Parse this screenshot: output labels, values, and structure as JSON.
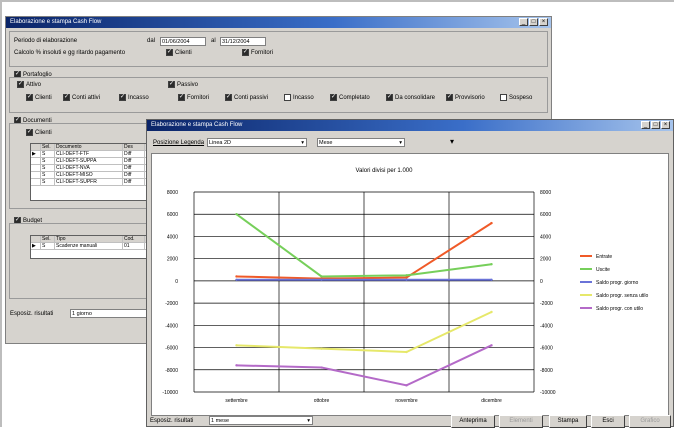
{
  "back_window": {
    "title": "Elaborazione e stampa Cash Flow",
    "periodo_label": "Periodo di elaborazione",
    "dal_label": "dal",
    "date_from": "01/06/2004",
    "al_label": "al",
    "date_to": "31/12/2004",
    "calcolo_label": "Calcolo % insoluti e gg ritardo pagamento",
    "clienti": "Clienti",
    "fornitori": "Fornitori",
    "portafoglio": "Portafoglio",
    "attivo": "Attivo",
    "attivo_items": [
      "Clienti",
      "Conti attivi",
      "Incasso"
    ],
    "passivo": "Passivo",
    "passivo_items": [
      "Fornitori",
      "Conti passivi",
      "Incasso"
    ],
    "right_items": [
      "Completato",
      "Da consolidare",
      "Provvisorio",
      "Sospeso"
    ],
    "documenti": "Documenti",
    "doc_clienti": "Clienti",
    "doc_headers": [
      "Sel.",
      "Documento",
      "Des"
    ],
    "doc_rows": [
      [
        "S",
        "CLI-DEFT-FTF",
        "Diff"
      ],
      [
        "S",
        "CLI-DEFT-SUPPA",
        "Diff"
      ],
      [
        "S",
        "CLI-DEFT-NVA",
        "Diff"
      ],
      [
        "S",
        "CLI-DEFT-MISO",
        "Diff"
      ],
      [
        "S",
        "CLI-DEFT-SUPFR",
        "Diff"
      ]
    ],
    "budget": "Budget",
    "budget_headers": [
      "Sel.",
      "Tipo",
      "Cod."
    ],
    "budget_rows": [
      [
        "S",
        "Scadenze manuali",
        "01"
      ]
    ],
    "esposiz_label": "Esposiz. risultati",
    "esposiz_value": "1 giorno"
  },
  "front_window": {
    "title": "Elaborazione e stampa Cash Flow",
    "posizione_label": "Posizione Legenda",
    "dropdown1": "Linea 2D",
    "dropdown2": "Mese",
    "esposiz_label": "Esposiz. risultati",
    "esposiz_value": "1 mese",
    "buttons": [
      "Anteprima",
      "Elementi",
      "Stampa",
      "Esci",
      "Grafico"
    ]
  },
  "chart_data": {
    "type": "line",
    "title": "Valori divisi per 1.000",
    "categories": [
      "settembre",
      "ottobre",
      "novembre",
      "dicembre"
    ],
    "ylim": [
      -10000,
      8000
    ],
    "yticks": [
      8000,
      6000,
      4000,
      2000,
      0,
      -2000,
      -4000,
      -6000,
      -8000,
      -10000
    ],
    "legend_position": "right",
    "series": [
      {
        "name": "Entrate",
        "color": "#f05a28",
        "values": [
          400,
          200,
          300,
          5200
        ]
      },
      {
        "name": "Uscite",
        "color": "#76cf5a",
        "values": [
          6000,
          400,
          500,
          1500
        ]
      },
      {
        "name": "Saldo progr. giorno",
        "color": "#6a73d8",
        "values": [
          100,
          100,
          100,
          100
        ]
      },
      {
        "name": "Saldo progr. senza utilo",
        "color": "#e6e86a",
        "values": [
          -5800,
          -6100,
          -6400,
          -2800
        ]
      },
      {
        "name": "Saldo progr. con utilo",
        "color": "#b46ac8",
        "values": [
          -7600,
          -7800,
          -9400,
          -5800
        ]
      }
    ]
  }
}
